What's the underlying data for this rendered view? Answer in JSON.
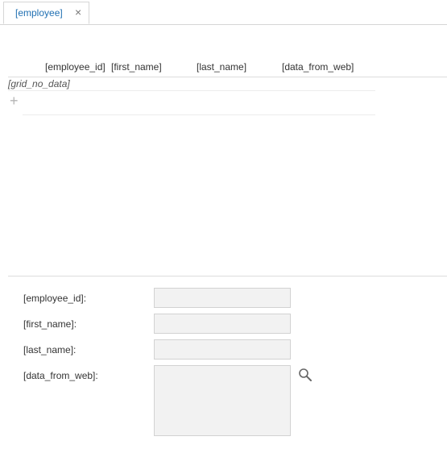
{
  "tab": {
    "label": "[employee]",
    "close_glyph": "×"
  },
  "grid": {
    "columns": [
      "[employee_id]",
      "[first_name]",
      "[last_name]",
      "[data_from_web]"
    ],
    "empty_text": "[grid_no_data]",
    "add_glyph": "+"
  },
  "form": {
    "fields": [
      {
        "label": "[employee_id]:",
        "value": ""
      },
      {
        "label": "[first_name]:",
        "value": ""
      },
      {
        "label": "[last_name]:",
        "value": ""
      },
      {
        "label": "[data_from_web]:",
        "value": ""
      }
    ],
    "lookup_icon": "search-icon"
  },
  "colors": {
    "tab_text": "#1f6fb2",
    "field_bg": "#f2f2f2",
    "border": "#d2d2d2"
  }
}
